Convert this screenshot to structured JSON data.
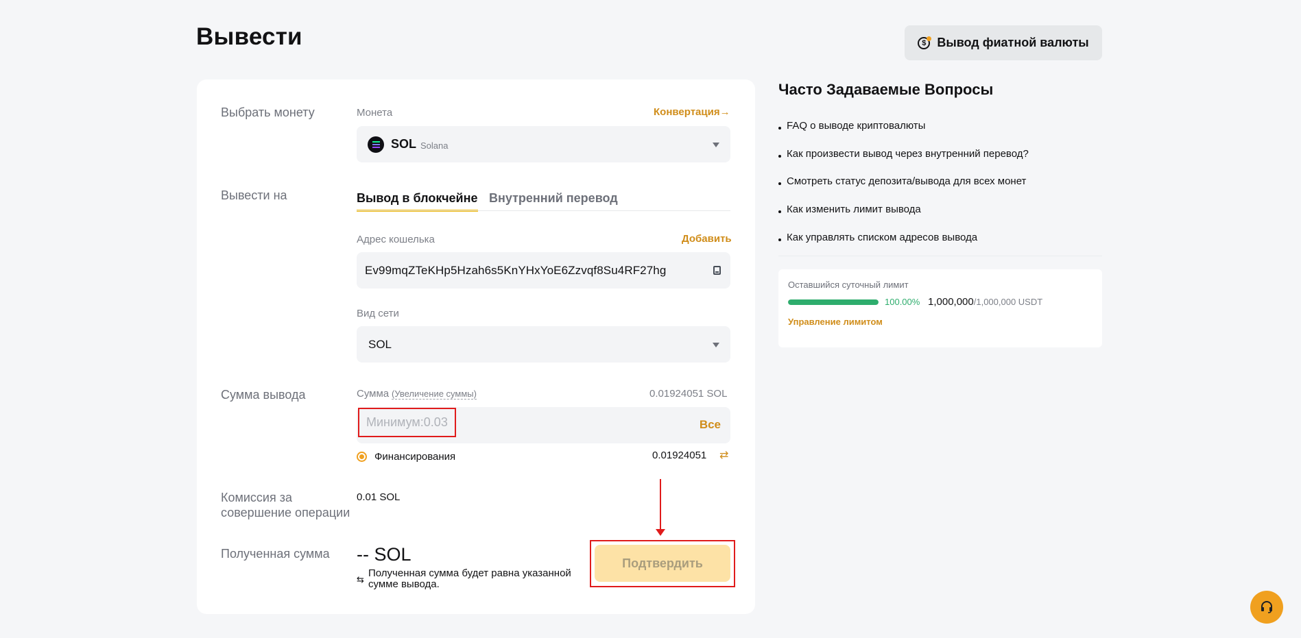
{
  "page": {
    "title": "Вывести"
  },
  "fiat_button": {
    "label": "Вывод фиатной валюты",
    "icon": "fiat-currency-icon"
  },
  "form": {
    "coin_row": {
      "label": "Выбрать монету",
      "field_label": "Монета",
      "convert_link": "Конвертация",
      "selected_symbol": "SOL",
      "selected_name": "Solana"
    },
    "destination_row": {
      "label": "Вывести на",
      "tabs": [
        {
          "label": "Вывод в блокчейне",
          "active": true
        },
        {
          "label": "Внутренний перевод",
          "active": false
        }
      ],
      "address_label": "Адрес кошелька",
      "add_link": "Добавить",
      "address_value": "Ev99mqZTeKHp5Hzah6s5KnYHxYoE6Zzvqf8Su4RF27hg",
      "network_label": "Вид сети",
      "network_value": "SOL"
    },
    "amount_row": {
      "label": "Сумма вывода",
      "field_label": "Сумма",
      "increase_link": "(Увеличение суммы)",
      "available": "0.01924051 SOL",
      "placeholder": "Минимум:0.03",
      "all_button": "Все",
      "funding_label": "Финансирования",
      "funding_value": "0.01924051"
    },
    "fee_row": {
      "label": "Комиссия за совершение операции",
      "value": "0.01 SOL"
    },
    "received_row": {
      "label": "Полученная сумма",
      "value": "-- SOL",
      "note": "Полученная сумма будет равна указанной сумме вывода.",
      "confirm_button": "Подтвердить"
    }
  },
  "faq": {
    "title": "Часто Задаваемые Вопросы",
    "items": [
      "FAQ о выводе криптовалюты",
      "Как произвести вывод через внутренний перевод?",
      "Смотреть статус депозита/вывода для всех монет",
      "Как изменить лимит вывода",
      "Как управлять списком адресов вывода"
    ]
  },
  "limit": {
    "title": "Оставшийся суточный лимит",
    "percent": "100.00%",
    "fill_fraction": 1.0,
    "used": "1,000,000",
    "total": "/1,000,000 USDT",
    "manage_link": "Управление лимитом"
  },
  "colors": {
    "accent": "#f0b90b",
    "link_orange": "#d08d1a",
    "progress_green": "#2ead6d",
    "highlight_red": "#e01b1b"
  }
}
